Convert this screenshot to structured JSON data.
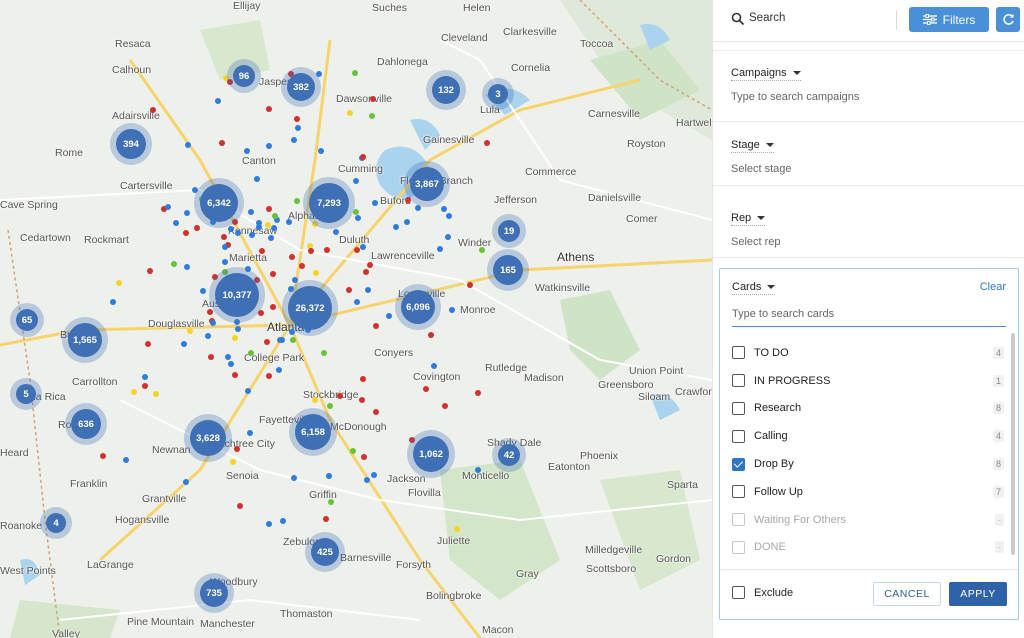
{
  "map": {
    "towns": [
      {
        "name": "Ellijay",
        "big": false
      },
      {
        "name": "Suches",
        "big": false
      },
      {
        "name": "Helen",
        "big": false
      },
      {
        "name": "Toccoa",
        "big": false
      },
      {
        "name": "Resaca",
        "big": false
      },
      {
        "name": "Calhoun",
        "big": false
      },
      {
        "name": "Jasper",
        "big": false
      },
      {
        "name": "Dahlonega",
        "big": false
      },
      {
        "name": "Cleveland",
        "big": false
      },
      {
        "name": "Clarkesville",
        "big": false
      },
      {
        "name": "Cornelia",
        "big": false
      },
      {
        "name": "Adairsville",
        "big": false
      },
      {
        "name": "Dawsonville",
        "big": false
      },
      {
        "name": "Lula",
        "big": false
      },
      {
        "name": "Carnesville",
        "big": false
      },
      {
        "name": "Rome",
        "big": false
      },
      {
        "name": "Gainesville",
        "big": false
      },
      {
        "name": "Royston",
        "big": false
      },
      {
        "name": "Hartwell",
        "big": false
      },
      {
        "name": "Canton",
        "big": false
      },
      {
        "name": "Cumming",
        "big": false
      },
      {
        "name": "Commerce",
        "big": false
      },
      {
        "name": "Cartersville",
        "big": false
      },
      {
        "name": "Flowery Branch",
        "big": false
      },
      {
        "name": "Danielsville",
        "big": false
      },
      {
        "name": "Cave Spring",
        "big": false
      },
      {
        "name": "Alpharetta",
        "big": false
      },
      {
        "name": "Buford",
        "big": false
      },
      {
        "name": "Jefferson",
        "big": false
      },
      {
        "name": "Comer",
        "big": false
      },
      {
        "name": "Cedartown",
        "big": false
      },
      {
        "name": "Rockmart",
        "big": false
      },
      {
        "name": "Kennesaw",
        "big": false
      },
      {
        "name": "Duluth",
        "big": false
      },
      {
        "name": "Winder",
        "big": false
      },
      {
        "name": "Athens",
        "big": true
      },
      {
        "name": "Marietta",
        "big": false
      },
      {
        "name": "Lawrenceville",
        "big": false
      },
      {
        "name": "Austell",
        "big": false
      },
      {
        "name": "Loganville",
        "big": false
      },
      {
        "name": "Watkinsville",
        "big": false
      },
      {
        "name": "Douglasville",
        "big": false
      },
      {
        "name": "Atlanta",
        "big": true
      },
      {
        "name": "Monroe",
        "big": false
      },
      {
        "name": "Bremen",
        "big": false
      },
      {
        "name": "College Park",
        "big": false
      },
      {
        "name": "Conyers",
        "big": false
      },
      {
        "name": "Carrollton",
        "big": false
      },
      {
        "name": "Rutledge",
        "big": false
      },
      {
        "name": "Madison",
        "big": false
      },
      {
        "name": "Union Point",
        "big": false
      },
      {
        "name": "Stockbridge",
        "big": false
      },
      {
        "name": "Covington",
        "big": false
      },
      {
        "name": "Greensboro",
        "big": false
      },
      {
        "name": "Crawford",
        "big": false
      },
      {
        "name": "Villa Rica",
        "big": false
      },
      {
        "name": "Siloam",
        "big": false
      },
      {
        "name": "Roopville",
        "big": false
      },
      {
        "name": "Fayetteville",
        "big": false
      },
      {
        "name": "McDonough",
        "big": false
      },
      {
        "name": "Peachtree City",
        "big": false
      },
      {
        "name": "Shady Dale",
        "big": false
      },
      {
        "name": "Phoenix",
        "big": false
      },
      {
        "name": "Heard",
        "big": false
      },
      {
        "name": "Newnan",
        "big": false
      },
      {
        "name": "Eatonton",
        "big": false
      },
      {
        "name": "Senoia",
        "big": false
      },
      {
        "name": "Jackson",
        "big": false
      },
      {
        "name": "Monticello",
        "big": false
      },
      {
        "name": "Franklin",
        "big": false
      },
      {
        "name": "Griffin",
        "big": false
      },
      {
        "name": "Flovilla",
        "big": false
      },
      {
        "name": "Sparta",
        "big": false
      },
      {
        "name": "Grantville",
        "big": false
      },
      {
        "name": "Roanoke",
        "big": false
      },
      {
        "name": "Hogansville",
        "big": false
      },
      {
        "name": "Juliette",
        "big": false
      },
      {
        "name": "Zebulon",
        "big": false
      },
      {
        "name": "Milledgeville",
        "big": false
      },
      {
        "name": "LaGrange",
        "big": false
      },
      {
        "name": "Barnesville",
        "big": false
      },
      {
        "name": "Gordon",
        "big": false
      },
      {
        "name": "West Points",
        "big": false
      },
      {
        "name": "Forsyth",
        "big": false
      },
      {
        "name": "Scottsboro",
        "big": false
      },
      {
        "name": "Gray",
        "big": false
      },
      {
        "name": "Woodbury",
        "big": false
      },
      {
        "name": "Bolingbroke",
        "big": false
      },
      {
        "name": "Thomaston",
        "big": false
      },
      {
        "name": "Pine Mountain",
        "big": false
      },
      {
        "name": "Manchester",
        "big": false
      },
      {
        "name": "Macon",
        "big": false
      },
      {
        "name": "Valley",
        "big": false
      }
    ],
    "clusters": [
      "96",
      "382",
      "132",
      "3",
      "394",
      "3,867",
      "6,342",
      "7,293",
      "19",
      "165",
      "10,377",
      "26,372",
      "6,096",
      "65",
      "1,565",
      "5",
      "636",
      "3,628",
      "6,158",
      "1,062",
      "42",
      "4",
      "425",
      "735"
    ],
    "colors": {
      "red": "#d32f2f",
      "blue": "#2f7be0",
      "yellow": "#f5d327",
      "green": "#67c23a"
    }
  },
  "panel": {
    "search_label": "Search",
    "filters_label": "Filters",
    "sections": [
      {
        "title": "Campaigns",
        "placeholder": "Type to search campaigns"
      },
      {
        "title": "Stage",
        "placeholder": "Select stage"
      },
      {
        "title": "Rep",
        "placeholder": "Select rep"
      }
    ],
    "cards": {
      "title": "Cards",
      "clear": "Clear",
      "placeholder": "Type to search cards",
      "options": [
        {
          "label": "TO DO",
          "count": "4",
          "checked": false,
          "disabled": false
        },
        {
          "label": "IN PROGRESS",
          "count": "1",
          "checked": false,
          "disabled": false
        },
        {
          "label": "Research",
          "count": "8",
          "checked": false,
          "disabled": false
        },
        {
          "label": "Calling",
          "count": "4",
          "checked": false,
          "disabled": false
        },
        {
          "label": "Drop By",
          "count": "8",
          "checked": true,
          "disabled": false
        },
        {
          "label": "Follow Up",
          "count": "7",
          "checked": false,
          "disabled": false
        },
        {
          "label": "Waiting For Others",
          "count": "-",
          "checked": false,
          "disabled": true
        },
        {
          "label": "DONE",
          "count": "-",
          "checked": false,
          "disabled": true
        }
      ],
      "exclude": "Exclude",
      "cancel": "CANCEL",
      "apply": "APPLY"
    }
  }
}
